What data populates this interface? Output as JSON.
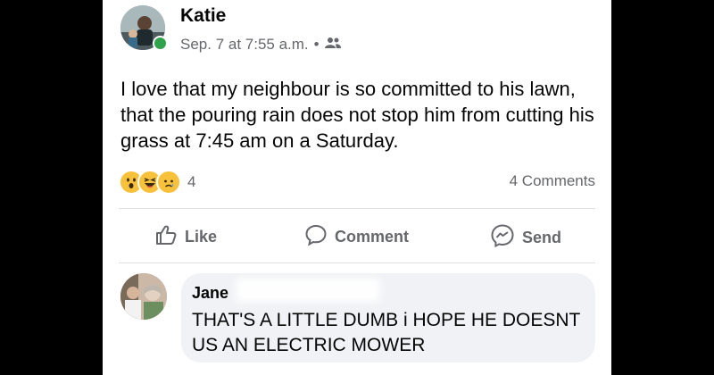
{
  "post": {
    "author_name": "Katie",
    "timestamp": "Sep. 7 at 7:55 a.m.",
    "separator": "•",
    "audience_icon": "friends-icon",
    "text": "I love that my neighbour is so committed to his lawn, that the pouring rain does not stop him from cutting his grass at 7:45 am on a Saturday.",
    "reaction_icons": [
      "wow-emoji",
      "haha-emoji",
      "sad-emoji"
    ],
    "reaction_count": "4",
    "comments_count": "4 Comments"
  },
  "actions": {
    "like_label": "Like",
    "comment_label": "Comment",
    "send_label": "Send"
  },
  "reply": {
    "author_name": "Jane",
    "text": "THAT'S A LITTLE DUMB  i HOPE HE DOESNT US AN ELECTRIC MOWER"
  },
  "colors": {
    "online": "#31a24c",
    "muted": "#65676b",
    "bubble": "#f0f2f5"
  }
}
